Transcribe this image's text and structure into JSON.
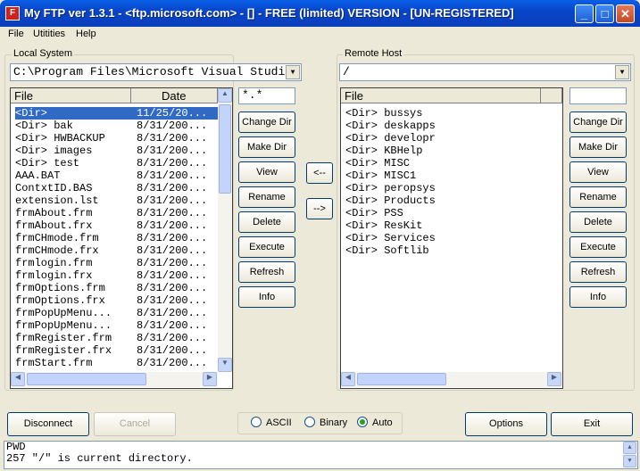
{
  "window": {
    "title": "My FTP ver 1.3.1 - <ftp.microsoft.com> - [] - FREE (limited) VERSION - [UN-REGISTERED]",
    "icon": "app-icon",
    "controls": [
      "minimize-icon",
      "maximize-icon",
      "close-icon"
    ]
  },
  "menu": [
    "File",
    "Utitities",
    "Help"
  ],
  "local": {
    "label": "Local System",
    "path": "C:\\Program Files\\Microsoft Visual Studio",
    "filter": "*.*",
    "columns": [
      "File",
      "Date"
    ],
    "items": [
      {
        "name": "<Dir>",
        "date": "11/25/20..."
      },
      {
        "name": "<Dir> bak",
        "date": "8/31/200..."
      },
      {
        "name": "<Dir> HWBACKUP",
        "date": "8/31/200..."
      },
      {
        "name": "<Dir> images",
        "date": "8/31/200..."
      },
      {
        "name": "<Dir> test",
        "date": "8/31/200..."
      },
      {
        "name": "AAA.BAT",
        "date": "8/31/200..."
      },
      {
        "name": "ContxtID.BAS",
        "date": "8/31/200..."
      },
      {
        "name": "extension.lst",
        "date": "8/31/200..."
      },
      {
        "name": "frmAbout.frm",
        "date": "8/31/200..."
      },
      {
        "name": "frmAbout.frx",
        "date": "8/31/200..."
      },
      {
        "name": "frmCHmode.frm",
        "date": "8/31/200..."
      },
      {
        "name": "frmCHmode.frx",
        "date": "8/31/200..."
      },
      {
        "name": "frmlogin.frm",
        "date": "8/31/200..."
      },
      {
        "name": "frmlogin.frx",
        "date": "8/31/200..."
      },
      {
        "name": "frmOptions.frm",
        "date": "8/31/200..."
      },
      {
        "name": "frmOptions.frx",
        "date": "8/31/200..."
      },
      {
        "name": "frmPopUpMenu...",
        "date": "8/31/200..."
      },
      {
        "name": "frmPopUpMenu...",
        "date": "8/31/200..."
      },
      {
        "name": "frmRegister.frm",
        "date": "8/31/200..."
      },
      {
        "name": "frmRegister.frx",
        "date": "8/31/200..."
      },
      {
        "name": "frmStart.frm",
        "date": "8/31/200..."
      }
    ],
    "buttons": [
      "Change Dir",
      "Make Dir",
      "View",
      "Rename",
      "Delete",
      "Execute",
      "Refresh",
      "Info"
    ]
  },
  "transfer": {
    "download": "<--",
    "upload": "-->"
  },
  "remote": {
    "label": "Remote Host",
    "path": "/",
    "filter": "",
    "columns": [
      "File"
    ],
    "items": [
      "<Dir> bussys",
      "<Dir> deskapps",
      "<Dir> developr",
      "<Dir> KBHelp",
      "<Dir> MISC",
      "<Dir> MISC1",
      "<Dir> peropsys",
      "<Dir> Products",
      "<Dir> PSS",
      "<Dir> ResKit",
      "<Dir> Services",
      "<Dir> Softlib"
    ],
    "buttons": [
      "Change Dir",
      "Make Dir",
      "View",
      "Rename",
      "Delete",
      "Execute",
      "Refresh",
      "Info"
    ]
  },
  "bottom": {
    "disconnect": "Disconnect",
    "cancel": "Cancel",
    "modes": [
      {
        "label": "ASCII",
        "selected": false
      },
      {
        "label": "Binary",
        "selected": false
      },
      {
        "label": "Auto",
        "selected": true
      }
    ],
    "options": "Options",
    "exit": "Exit"
  },
  "log": [
    "PWD",
    "257 \"/\" is current directory."
  ]
}
